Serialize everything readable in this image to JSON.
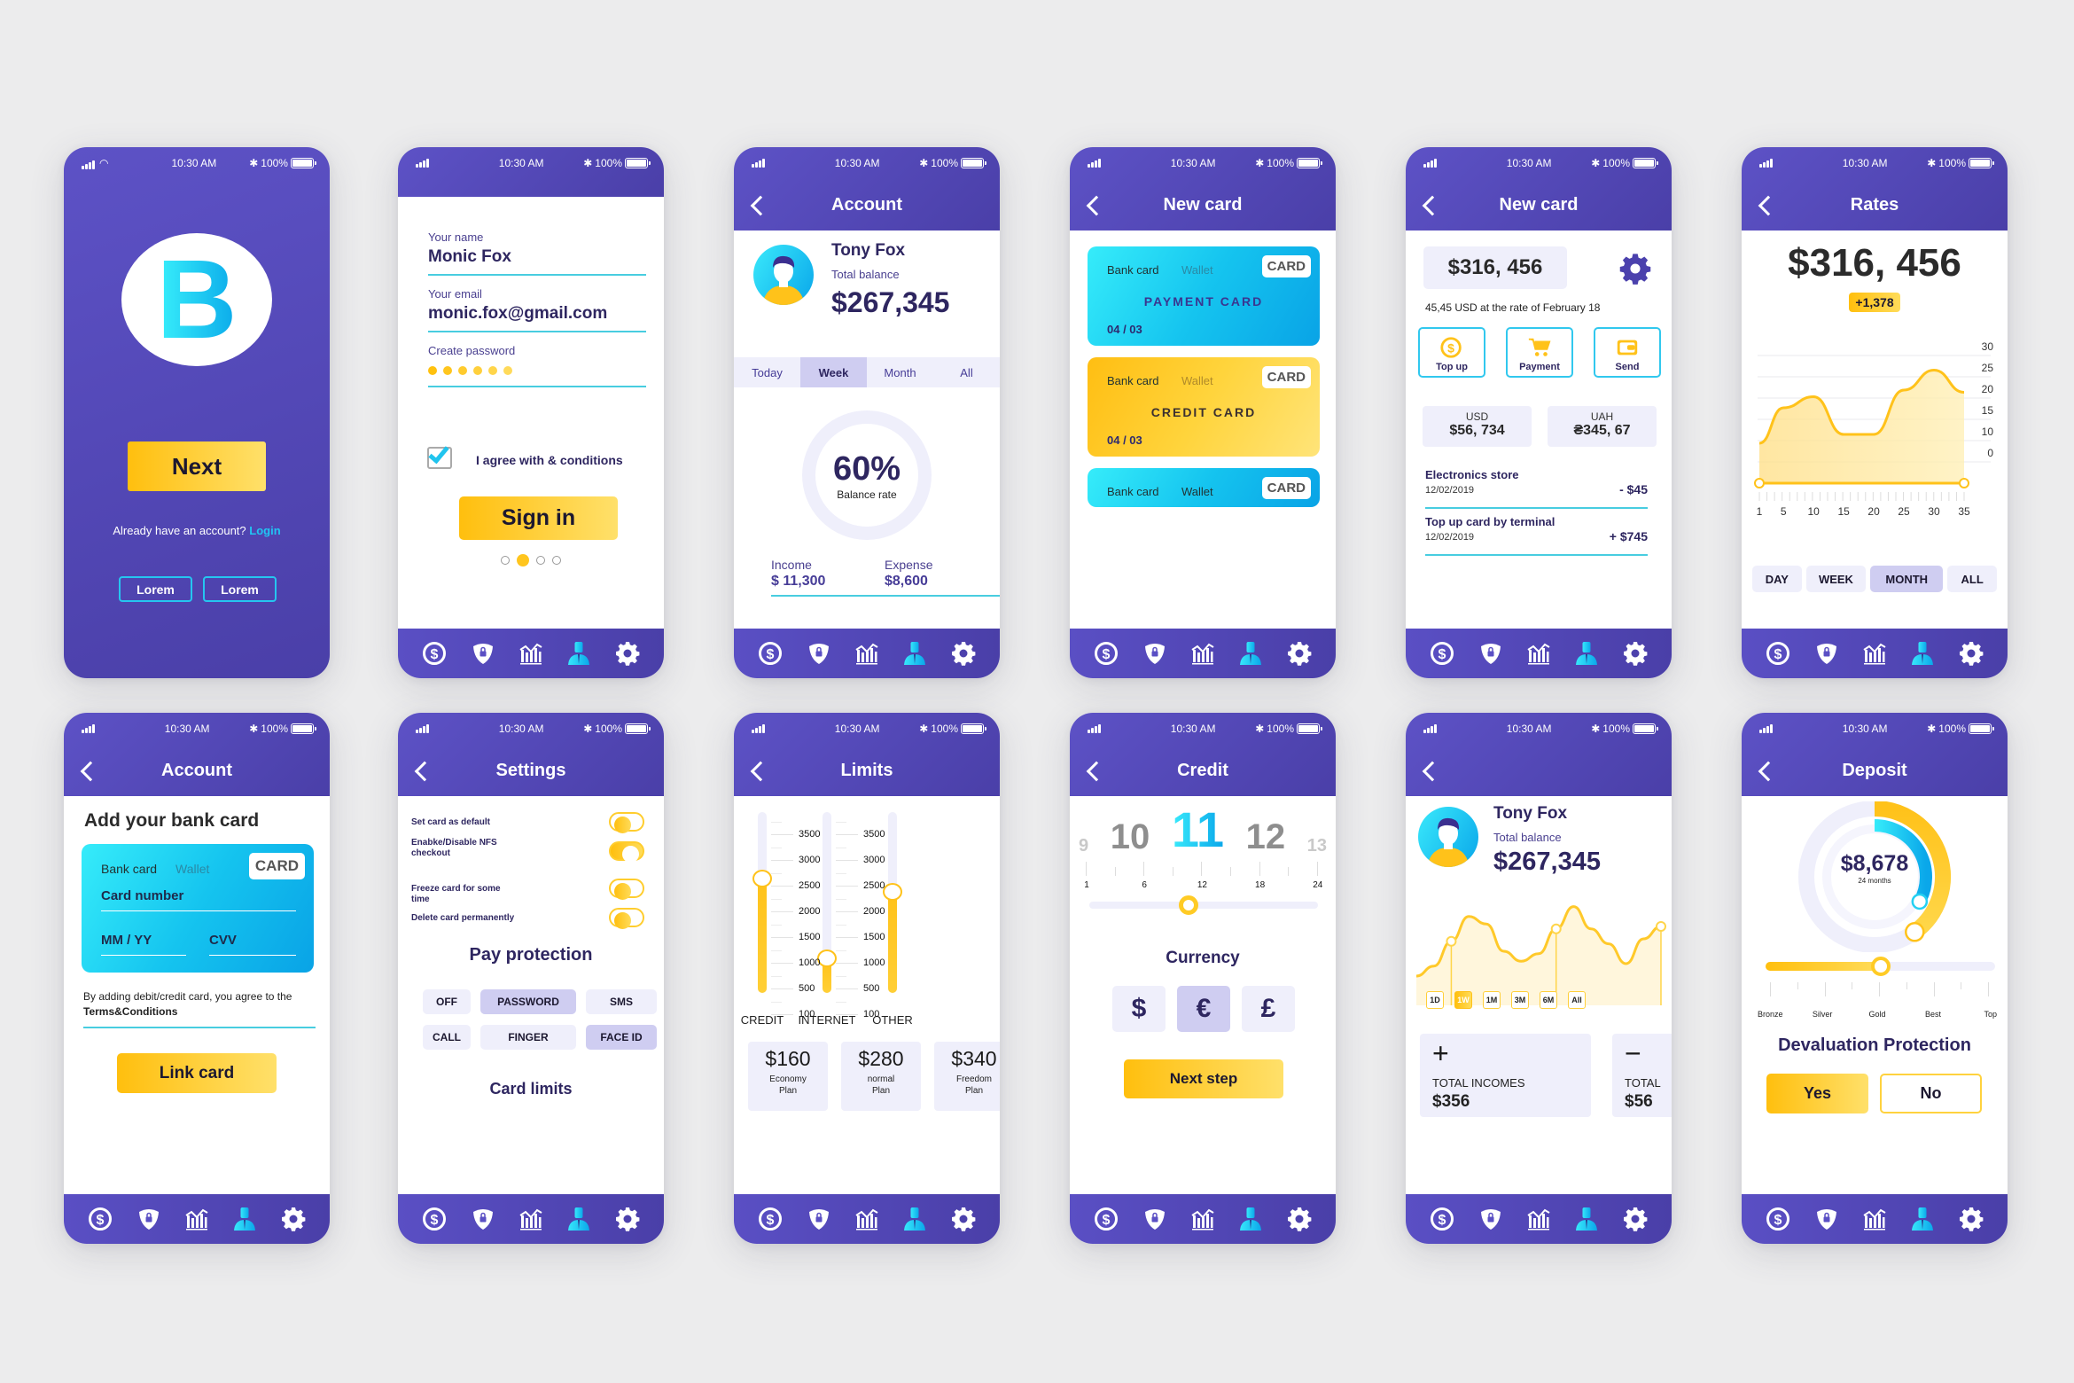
{
  "status_bar": {
    "time": "10:30 AM",
    "battery": "100%"
  },
  "tabbar_icons": [
    "dollar-icon",
    "shield-lock-icon",
    "chart-icon",
    "user-icon",
    "gear-icon"
  ],
  "colors": {
    "primary": "#5a4fc4",
    "accent_yellow": "#ffc21a",
    "accent_cyan": "#1fd0f2",
    "text_dark": "#2e2660"
  },
  "screens": {
    "welcome": {
      "logo_letter": "B",
      "next_label": "Next",
      "account_prompt": "Already have an account?",
      "login_link": "Login",
      "lorem_1": "Lorem",
      "lorem_2": "Lorem"
    },
    "signup": {
      "name_label": "Your name",
      "name_value": "Monic Fox",
      "email_label": "Your email",
      "email_value": "monic.fox@gmail.com",
      "password_label": "Create password",
      "password_length": 6,
      "agree_label": "I agree with & conditions",
      "agree_checked": true,
      "signin_label": "Sign in",
      "page_dots": 4,
      "active_dot": 2
    },
    "account": {
      "title": "Account",
      "name": "Tony Fox",
      "balance_label": "Total balance",
      "balance": "$267,345",
      "tabs": [
        "Today",
        "Week",
        "Month",
        "All"
      ],
      "active_tab": "Week",
      "rate_value": "60%",
      "rate_label": "Balance rate",
      "income_label": "Income",
      "income_value": "$ 11,300",
      "expense_label": "Expense",
      "expense_value": "$8,600"
    },
    "new_card_list": {
      "title": "New card",
      "cards": [
        {
          "tab1": "Bank card",
          "tab2": "Wallet",
          "tag": "CARD",
          "name": "PAYMENT CARD",
          "date": "04 / 03",
          "style": "cyan"
        },
        {
          "tab1": "Bank card",
          "tab2": "Wallet",
          "tag": "CARD",
          "name": "CREDIT CARD",
          "date": "04 / 03",
          "style": "yellow"
        },
        {
          "tab1": "Bank card",
          "tab2": "Wallet",
          "tag": "CARD",
          "name": "",
          "date": "",
          "style": "cyan"
        }
      ]
    },
    "new_card_wallet": {
      "title": "New card",
      "balance": "$316, 456",
      "rate_note": "45,45 USD at the rate of February 18",
      "actions": [
        {
          "label": "Top up",
          "icon": "coin-icon"
        },
        {
          "label": "Payment",
          "icon": "cart-icon"
        },
        {
          "label": "Send",
          "icon": "wallet-icon"
        }
      ],
      "currencies": [
        {
          "code": "USD",
          "value": "$56, 734"
        },
        {
          "code": "UAH",
          "value": "₴345, 67"
        }
      ],
      "transactions": [
        {
          "title": "Electronics store",
          "date": "12/02/2019",
          "amount": "- $45"
        },
        {
          "title": "Top up card by terminal",
          "date": "12/02/2019",
          "amount": "+ $745"
        }
      ]
    },
    "rates": {
      "title": "Rates",
      "value": "$316, 456",
      "change": "+1,378",
      "periods": [
        "DAY",
        "WEEK",
        "MONTH",
        "ALL"
      ],
      "active_period": "MONTH"
    },
    "add_card": {
      "title": "Account",
      "heading": "Add your bank card",
      "tab1": "Bank card",
      "tab2": "Wallet",
      "tag": "CARD",
      "card_number_placeholder": "Card number",
      "expiry_placeholder": "MM / YY",
      "cvv_placeholder": "CVV",
      "terms_text": "By adding debit/credit card, you agree to the",
      "terms_link": "Terms&Conditions",
      "link_label": "Link card"
    },
    "settings": {
      "title": "Settings",
      "toggles": [
        {
          "label": "Set card as default",
          "on": false
        },
        {
          "label": "Enabke/Disable NFS checkout",
          "on": true
        },
        {
          "label": "Freeze card for some time",
          "on": false
        },
        {
          "label": "Delete card permanently",
          "on": false
        }
      ],
      "protection_heading": "Pay protection",
      "protection_options": [
        "OFF",
        "PASSWORD",
        "SMS",
        "CALL",
        "FINGER",
        "FACE ID"
      ],
      "protection_selected": [
        "PASSWORD",
        "FACE ID"
      ],
      "limits_link": "Card limits"
    },
    "limits": {
      "title": "Limits",
      "scale": [
        "3500",
        "3000",
        "2500",
        "2000",
        "1500",
        "1000",
        "500",
        "100"
      ],
      "sliders": [
        {
          "label": "CREDIT",
          "value": 2600
        },
        {
          "label": "INTERNET",
          "value": 1050
        },
        {
          "label": "OTHER",
          "value": 2350
        }
      ],
      "plans": [
        {
          "price": "$160",
          "name": "Economy Plan"
        },
        {
          "price": "$280",
          "name": "normal Plan"
        },
        {
          "price": "$340",
          "name": "Freedom Plan"
        }
      ]
    },
    "credit": {
      "title": "Credit",
      "picker": [
        "9",
        "10",
        "11",
        "12",
        "13"
      ],
      "picker_selected": "11",
      "scale_labels": [
        "1",
        "6",
        "12",
        "18",
        "24"
      ],
      "slider_value": 11,
      "slider_min": 1,
      "slider_max": 24,
      "currency_heading": "Currency",
      "currencies": [
        "$",
        "€",
        "£"
      ],
      "currency_selected": "€",
      "next_label": "Next step"
    },
    "profile_chart": {
      "name": "Tony Fox",
      "balance_label": "Total balance",
      "balance": "$267,345",
      "ranges": [
        "1D",
        "1W",
        "1M",
        "3M",
        "6M",
        "All"
      ],
      "active_range": "1W",
      "incomes_label": "TOTAL INCOMES",
      "incomes_value": "$356",
      "expenses_label": "TOTAL",
      "expenses_value": "$56"
    },
    "deposit": {
      "title": "Deposit",
      "amount": "$8,678",
      "term": "24 months",
      "outer_progress": 0.4,
      "inner_progress": 0.33,
      "tiers": [
        "Bronze",
        "Silver",
        "Gold",
        "Best",
        "Top"
      ],
      "tier_value": 0.5,
      "protection_heading": "Devaluation Protection",
      "yes_label": "Yes",
      "no_label": "No"
    }
  },
  "chart_data": [
    {
      "type": "area",
      "title": "Rates",
      "x": [
        1,
        5,
        10,
        15,
        20,
        25,
        30,
        35
      ],
      "series": [
        {
          "name": "rate",
          "values": [
            9,
            17,
            19.5,
            11,
            11,
            21,
            25.5,
            20.5
          ]
        }
      ],
      "xticks": [
        "1",
        "5",
        "10",
        "15",
        "20",
        "25",
        "30",
        "35"
      ],
      "yticks": [
        "30",
        "25",
        "20",
        "15",
        "10",
        "0"
      ],
      "ylim": [
        0,
        30
      ],
      "grid": true,
      "legend": "none"
    },
    {
      "type": "area",
      "title": "Total balance",
      "x": [
        1,
        2,
        3,
        4,
        5,
        6,
        7,
        8,
        9,
        10,
        11,
        12,
        13,
        14,
        15
      ],
      "series": [
        {
          "name": "balance",
          "values": [
            20,
            28,
            48,
            68,
            62,
            40,
            32,
            38,
            58,
            76,
            58,
            46,
            30,
            50,
            60
          ]
        }
      ],
      "markers": [
        3,
        9,
        15
      ],
      "ylim": [
        0,
        100
      ],
      "grid": false,
      "legend": "none"
    }
  ]
}
